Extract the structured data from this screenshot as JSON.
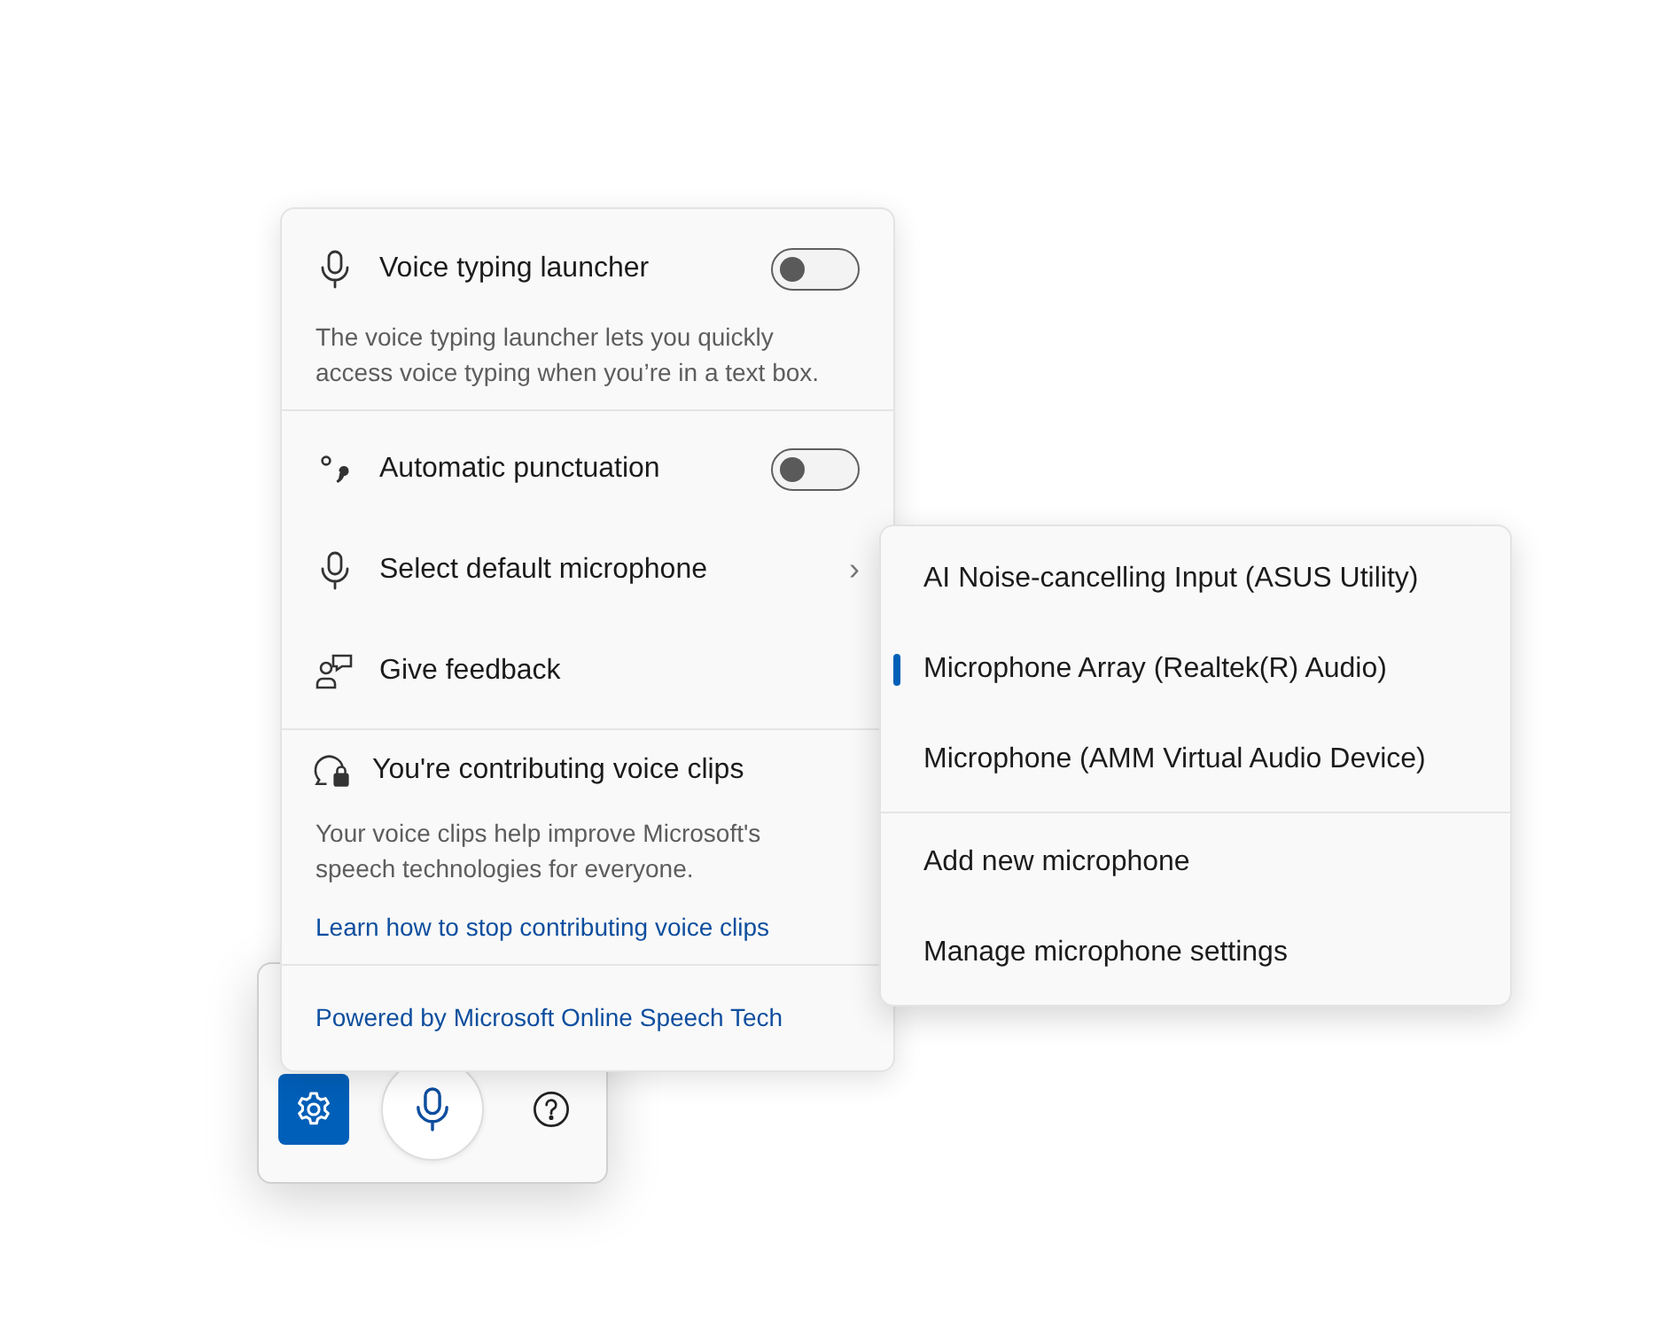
{
  "settings_panel": {
    "launcher": {
      "label": "Voice typing launcher",
      "on": false,
      "description": "The voice typing launcher lets you quickly access voice typing when you’re in a text box."
    },
    "items": [
      {
        "kind": "toggle",
        "label": "Automatic punctuation",
        "on": false
      },
      {
        "kind": "submenu",
        "label": "Select default microphone",
        "chevron": "›"
      },
      {
        "kind": "action",
        "label": "Give feedback"
      }
    ],
    "contribution": {
      "heading": "You're contributing voice clips",
      "description": "Your voice clips help improve Microsoft's speech technologies for everyone.",
      "link": "Learn how to stop contributing voice clips"
    },
    "footer_link": "Powered by Microsoft Online Speech Tech"
  },
  "microphone_menu": {
    "devices": [
      {
        "label": "AI Noise-cancelling Input (ASUS Utility)",
        "selected": false
      },
      {
        "label": "Microphone Array (Realtek(R) Audio)",
        "selected": true
      },
      {
        "label": "Microphone (AMM Virtual Audio Device)",
        "selected": false
      }
    ],
    "actions": [
      "Add new microphone",
      "Manage microphone settings"
    ]
  },
  "toolbar": {
    "buttons": [
      {
        "kind": "settings",
        "selected": true
      },
      {
        "kind": "mic",
        "selected": false
      },
      {
        "kind": "help",
        "selected": false
      }
    ]
  }
}
